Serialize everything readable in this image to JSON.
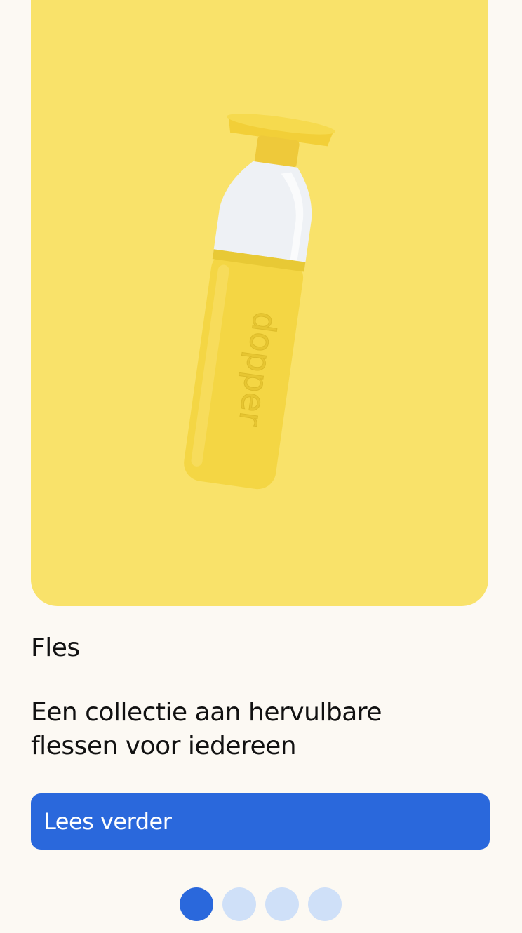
{
  "product": {
    "category": "Fles",
    "description": "Een collectie aan hervulbare flessen voor iedereen",
    "image_alt": "Gele hervulbare fles",
    "bottle_brand_text": "dopper"
  },
  "cta": {
    "label": "Lees verder"
  },
  "pagination": {
    "total": 4,
    "active_index": 0
  },
  "colors": {
    "page_background": "#fcf9f3",
    "card_background": "#f9e26a",
    "bottle_yellow": "#f4d644",
    "accent_blue": "#2a68dc",
    "dot_inactive": "#cfe0f8"
  }
}
